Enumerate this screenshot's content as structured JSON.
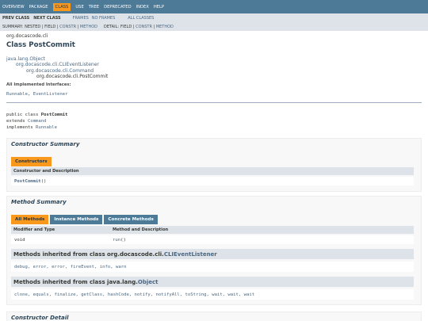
{
  "topnav": [
    "Overview",
    "Package",
    "Class",
    "Use",
    "Tree",
    "Deprecated",
    "Index",
    "Help"
  ],
  "topnav_active": "Class",
  "subnav": {
    "prev_class": "Prev Class",
    "next_class": "Next Class",
    "frames": "Frames",
    "no_frames": "No Frames",
    "all_classes": "All Classes",
    "summary_prefix": "Summary:",
    "summary_items": [
      "Nested",
      "Field",
      "Constr",
      "Method"
    ],
    "detail_prefix": "Detail:",
    "detail_items": [
      "Field",
      "Constr",
      "Method"
    ]
  },
  "package": "org.docascode.cli",
  "class_title": "Class PostCommit",
  "inheritance": [
    "java.lang.Object",
    "org.docascode.cli.CLIEventListener",
    "org.docascode.cli.Command",
    "org.docascode.cli.PostCommit"
  ],
  "interfaces_label": "All Implemented Interfaces:",
  "interfaces": [
    "Runnable",
    "EventListener"
  ],
  "signature": {
    "line1_pre": "public class ",
    "line1_name": "PostCommit",
    "line2_pre": "extends ",
    "line2_link": "Command",
    "line3_pre": "implements ",
    "line3_link": "Runnable"
  },
  "constructor_summary": {
    "heading": "Constructor Summary",
    "tab": "Constructors",
    "col": "Constructor and Description",
    "row": "PostCommit",
    "row_suffix": "()"
  },
  "method_summary": {
    "heading": "Method Summary",
    "tabs": [
      "All Methods",
      "Instance Methods",
      "Concrete Methods"
    ],
    "active_tab": "All Methods",
    "col1": "Modifier and Type",
    "col2": "Method and Description",
    "row_type": "void",
    "row_method": "run",
    "row_suffix": "()"
  },
  "inherited_1": {
    "prefix": "Methods inherited from class org.docascode.cli.",
    "cls": "CLIEventListener",
    "methods": "debug, error, error, fireEvent, info, warn"
  },
  "inherited_2": {
    "prefix": "Methods inherited from class java.lang.",
    "cls": "Object",
    "methods": "clone, equals, finalize, getClass, hashCode, notify, notifyAll, toString, wait, wait, wait"
  },
  "constructor_detail": {
    "heading": "Constructor Detail"
  }
}
